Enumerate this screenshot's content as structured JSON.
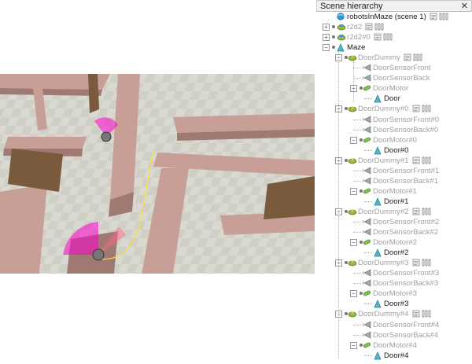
{
  "panel": {
    "title": "Scene hierarchy",
    "close_glyph": "✕"
  },
  "tree": [
    {
      "label": "robotsInMaze (scene 1)",
      "icon": "scene-icon",
      "depth": 0,
      "dim": false,
      "expander": "",
      "extras": [
        "script-icon",
        "params-icon"
      ]
    },
    {
      "label": "r2d2",
      "icon": "robot-icon",
      "depth": 0,
      "dim": true,
      "expander": "+",
      "extras": [
        "script-icon",
        "params-icon"
      ]
    },
    {
      "label": "r2d2#0",
      "icon": "robot-icon",
      "depth": 0,
      "dim": true,
      "expander": "+",
      "extras": [
        "script-icon",
        "params-icon"
      ]
    },
    {
      "label": "Maze",
      "icon": "shape-icon",
      "depth": 0,
      "dim": false,
      "expander": "−",
      "extras": []
    },
    {
      "label": "DoorDummy",
      "icon": "dummy-icon",
      "depth": 1,
      "dim": true,
      "expander": "−",
      "extras": [
        "script-icon",
        "params-icon"
      ]
    },
    {
      "label": "DoorSensorFront",
      "icon": "sensor-icon",
      "depth": 2,
      "dim": true,
      "expander": "",
      "extras": []
    },
    {
      "label": "DoorSensorBack",
      "icon": "sensor-icon",
      "depth": 2,
      "dim": true,
      "expander": "",
      "extras": []
    },
    {
      "label": "DoorMotor",
      "icon": "motor-icon",
      "depth": 2,
      "dim": true,
      "expander": "−",
      "extras": []
    },
    {
      "label": "Door",
      "icon": "shape-icon",
      "depth": 3,
      "dim": false,
      "expander": "",
      "extras": []
    },
    {
      "label": "DoorDummy#0",
      "icon": "dummy-icon",
      "depth": 1,
      "dim": true,
      "expander": "−",
      "extras": [
        "script-icon",
        "params-icon"
      ]
    },
    {
      "label": "DoorSensorFront#0",
      "icon": "sensor-icon",
      "depth": 2,
      "dim": true,
      "expander": "",
      "extras": []
    },
    {
      "label": "DoorSensorBack#0",
      "icon": "sensor-icon",
      "depth": 2,
      "dim": true,
      "expander": "",
      "extras": []
    },
    {
      "label": "DoorMotor#0",
      "icon": "motor-icon",
      "depth": 2,
      "dim": true,
      "expander": "−",
      "extras": []
    },
    {
      "label": "Door#0",
      "icon": "shape-icon",
      "depth": 3,
      "dim": false,
      "expander": "",
      "extras": []
    },
    {
      "label": "DoorDummy#1",
      "icon": "dummy-icon",
      "depth": 1,
      "dim": true,
      "expander": "−",
      "extras": [
        "script-icon",
        "params-icon"
      ]
    },
    {
      "label": "DoorSensorFront#1",
      "icon": "sensor-icon",
      "depth": 2,
      "dim": true,
      "expander": "",
      "extras": []
    },
    {
      "label": "DoorSensorBack#1",
      "icon": "sensor-icon",
      "depth": 2,
      "dim": true,
      "expander": "",
      "extras": []
    },
    {
      "label": "DoorMotor#1",
      "icon": "motor-icon",
      "depth": 2,
      "dim": true,
      "expander": "−",
      "extras": []
    },
    {
      "label": "Door#1",
      "icon": "shape-icon",
      "depth": 3,
      "dim": false,
      "expander": "",
      "extras": []
    },
    {
      "label": "DoorDummy#2",
      "icon": "dummy-icon",
      "depth": 1,
      "dim": true,
      "expander": "−",
      "extras": [
        "script-icon",
        "params-icon"
      ]
    },
    {
      "label": "DoorSensorFront#2",
      "icon": "sensor-icon",
      "depth": 2,
      "dim": true,
      "expander": "",
      "extras": []
    },
    {
      "label": "DoorSensorBack#2",
      "icon": "sensor-icon",
      "depth": 2,
      "dim": true,
      "expander": "",
      "extras": []
    },
    {
      "label": "DoorMotor#2",
      "icon": "motor-icon",
      "depth": 2,
      "dim": true,
      "expander": "−",
      "extras": []
    },
    {
      "label": "Door#2",
      "icon": "shape-icon",
      "depth": 3,
      "dim": false,
      "expander": "",
      "extras": []
    },
    {
      "label": "DoorDummy#3",
      "icon": "dummy-icon",
      "depth": 1,
      "dim": true,
      "expander": "−",
      "extras": [
        "script-icon",
        "params-icon"
      ]
    },
    {
      "label": "DoorSensorFront#3",
      "icon": "sensor-icon",
      "depth": 2,
      "dim": true,
      "expander": "",
      "extras": []
    },
    {
      "label": "DoorSensorBack#3",
      "icon": "sensor-icon",
      "depth": 2,
      "dim": true,
      "expander": "",
      "extras": []
    },
    {
      "label": "DoorMotor#3",
      "icon": "motor-icon",
      "depth": 2,
      "dim": true,
      "expander": "−",
      "extras": []
    },
    {
      "label": "Door#3",
      "icon": "shape-icon",
      "depth": 3,
      "dim": false,
      "expander": "",
      "extras": []
    },
    {
      "label": "DoorDummy#4",
      "icon": "dummy-icon",
      "depth": 1,
      "dim": true,
      "expander": "−",
      "extras": [
        "script-icon",
        "params-icon"
      ]
    },
    {
      "label": "DoorSensorFront#4",
      "icon": "sensor-icon",
      "depth": 2,
      "dim": true,
      "expander": "",
      "extras": []
    },
    {
      "label": "DoorSensorBack#4",
      "icon": "sensor-icon",
      "depth": 2,
      "dim": true,
      "expander": "",
      "extras": []
    },
    {
      "label": "DoorMotor#4",
      "icon": "motor-icon",
      "depth": 2,
      "dim": true,
      "expander": "−",
      "extras": []
    },
    {
      "label": "Door#4",
      "icon": "shape-icon",
      "depth": 3,
      "dim": false,
      "expander": "",
      "extras": []
    }
  ],
  "colors": {
    "wall_top": "#c89f97",
    "wall_side": "#9e7a72",
    "door": "#7a5a3c",
    "floor": "#c9c9c0",
    "sensor_cone": "#ff00cc",
    "trajectory": "#ffdd33",
    "dim_text": "#a0a0a0"
  }
}
